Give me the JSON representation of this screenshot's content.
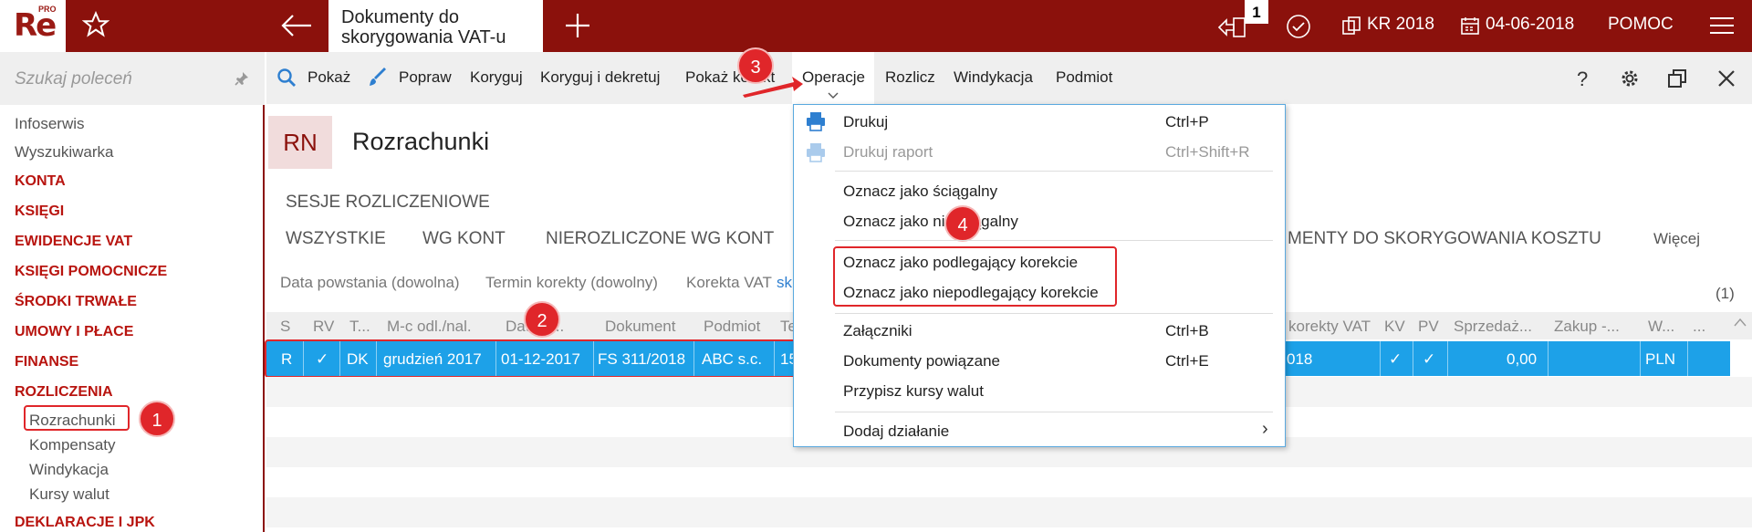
{
  "app": {
    "logo": "Re",
    "logo_sup": "PRO",
    "doc_tab": "Dokumenty do skorygowania VAT-u",
    "badge": "1",
    "year": "KR 2018",
    "date": "04-06-2018",
    "help": "POMOC"
  },
  "sidebar": {
    "search_placeholder": "Szukaj poleceń",
    "items": [
      {
        "label": "Infoserwis",
        "style": "grey"
      },
      {
        "label": "Wyszukiwarka",
        "style": "grey"
      },
      {
        "label": "KONTA",
        "style": "red"
      },
      {
        "label": "KSIĘGI",
        "style": "red"
      },
      {
        "label": "EWIDENCJE VAT",
        "style": "red"
      },
      {
        "label": "KSIĘGI POMOCNICZE",
        "style": "red"
      },
      {
        "label": "ŚRODKI TRWAŁE",
        "style": "red"
      },
      {
        "label": "UMOWY I PŁACE",
        "style": "red"
      },
      {
        "label": "FINANSE",
        "style": "red"
      },
      {
        "label": "ROZLICZENIA",
        "style": "red"
      },
      {
        "label": "Rozrachunki",
        "style": "sub"
      },
      {
        "label": "Kompensaty",
        "style": "sub"
      },
      {
        "label": "Windykacja",
        "style": "sub"
      },
      {
        "label": "Kursy walut",
        "style": "sub"
      },
      {
        "label": "DEKLARACJE I JPK",
        "style": "red"
      }
    ]
  },
  "toolbar": {
    "show": "Pokaż",
    "fix": "Popraw",
    "correct": "Koryguj",
    "correct_post": "Koryguj i dekretuj",
    "show_corr": "Pokaż korekt",
    "operations": "Operacje",
    "settle": "Rozlicz",
    "recovery": "Windykacja",
    "entity": "Podmiot"
  },
  "main": {
    "badge": "RN",
    "title": "Rozrachunki",
    "section": "SESJE ROZLICZENIOWE",
    "tabs": [
      "WSZYSTKIE",
      "WG KONT",
      "NIEROZLICZONE WG KONT"
    ],
    "tab_right": "MENTY DO SKORYGOWANIA KOSZTU",
    "more": "Więcej",
    "filters": [
      "Data powstania (dowolna)",
      "Termin korekty (dowolny)",
      "Korekta VAT",
      "sk"
    ],
    "count": "(1)",
    "columns": [
      "S",
      "RV",
      "T...",
      "M-c odl./nal.",
      "Data o...",
      "Dokument",
      "Podmiot",
      "Te",
      "korekty VAT",
      "KV",
      "PV",
      "Sprzedaż...",
      "Zakup -...",
      "W...",
      "..."
    ],
    "row": {
      "s": "R",
      "rv": "✓",
      "t": "DK",
      "month": "grudzień 2017",
      "date": "01-12-2017",
      "doc": "FS 311/2018",
      "entity": "ABC s.c.",
      "te": "15",
      "corr": "018",
      "kv": "✓",
      "pv": "✓",
      "sale": "0,00",
      "currency": "PLN"
    }
  },
  "menu": {
    "items": [
      {
        "label": "Drukuj",
        "shortcut": "Ctrl+P"
      },
      {
        "label": "Drukuj raport",
        "shortcut": "Ctrl+Shift+R"
      },
      {
        "label": "Oznacz jako ściągalny"
      },
      {
        "label": "Oznacz jako nieściągalny"
      },
      {
        "label": "Oznacz jako podlegający korekcie"
      },
      {
        "label": "Oznacz jako niepodlegający korekcie"
      },
      {
        "label": "Załączniki",
        "shortcut": "Ctrl+B"
      },
      {
        "label": "Dokumenty powiązane",
        "shortcut": "Ctrl+E"
      },
      {
        "label": "Przypisz kursy walut"
      },
      {
        "label": "Dodaj działanie",
        "submenu": "›"
      }
    ]
  },
  "steps": [
    "1",
    "2",
    "3",
    "4"
  ],
  "colors": {
    "brand": "#8b110c",
    "selection": "#1da1e8",
    "annotation": "#e0262a"
  }
}
